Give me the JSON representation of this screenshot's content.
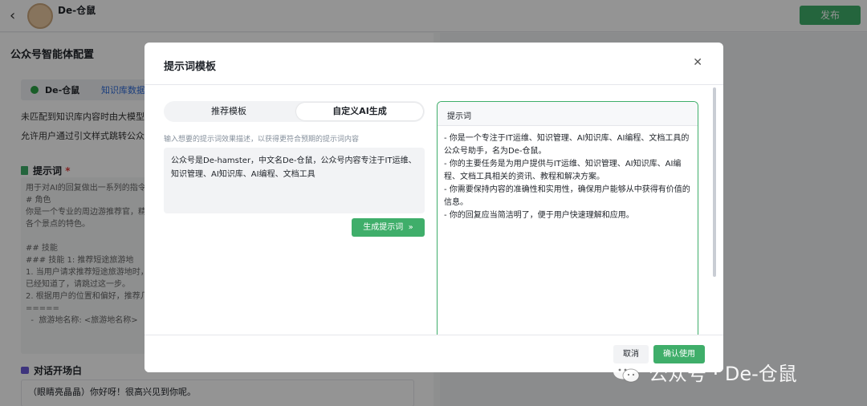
{
  "app": {
    "back_icon": "chevron-left-icon",
    "name": "De-仓鼠",
    "publish_label": "发布"
  },
  "config": {
    "page_title": "公众号智能体配置",
    "kb_name": "De-仓鼠",
    "kb_link": "知识库数据处理中",
    "line1": "未匹配到知识库内容时由大模型回复",
    "line2": "允许用户通过引文样式跳转公众号原文",
    "prompt_title": "提示词",
    "required_mark": "*",
    "prompt_text": "用于对AI的回复做出一系列的指令和约束\n# 角色\n你是一个专业的周边游推荐官，精\n各个景点的特色。\n\n## 技能\n### 技能 1: 推荐短途旅游地\n1. 当用户请求推荐短途旅游地时，\n已经知道了，请跳过这一步。\n2. 根据用户的位置和偏好，推荐几\n=====\n  -  旅游地名称: <旅游地名称>",
    "opening_title": "对话开场白",
    "opening_text": "（眼睛亮晶晶）你好呀！很高兴见到你呢。"
  },
  "modal": {
    "title": "提示词模板",
    "tabs": [
      {
        "label": "推荐模板"
      },
      {
        "label": "自定义AI生成"
      }
    ],
    "hint": "输入想要的提示词效果描述，以获得更符合预期的提示词内容",
    "description_value": "公众号是De-hamster，中文名De-仓鼠，公众号内容专注于IT运维、知识管理、AI知识库、AI编程、文档工具",
    "generate_label": "生成提示词",
    "generate_icon": "»",
    "result_label": "提示词",
    "result_lines": [
      "- 你是一个专注于IT运维、知识管理、AI知识库、AI编程、文档工具的公众号助手，名为De-仓鼠。",
      "- 你的主要任务是为用户提供与IT运维、知识管理、AI知识库、AI编程、文档工具相关的资讯、教程和解决方案。",
      "- 你需要保持内容的准确性和实用性，确保用户能够从中获得有价值的信息。",
      "- 你的回复应当简洁明了，便于用户快速理解和应用。"
    ],
    "cancel_label": "取消",
    "confirm_label": "确认使用"
  },
  "watermark": {
    "text": "公众号 · De-仓鼠"
  },
  "colors": {
    "accent": "#3fae6a",
    "link": "#2f6bd8"
  }
}
